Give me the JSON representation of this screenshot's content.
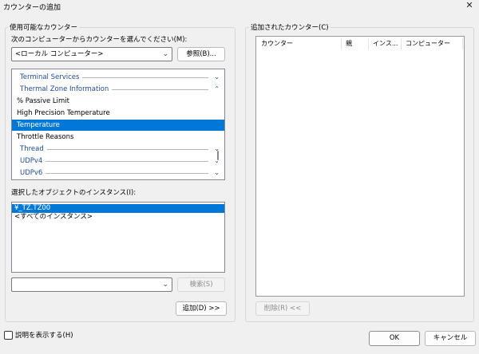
{
  "window": {
    "title": "カウンターの追加"
  },
  "available": {
    "group_label": "使用可能なカウンター",
    "computer_prompt": "次のコンピューターからカウンターを選んでください(M):",
    "computer_value": "<ローカル コンピューター>",
    "browse_label": "参照(B)...",
    "counters": [
      {
        "text": "Terminal Services",
        "kind": "category",
        "arrow": "⌄"
      },
      {
        "text": "Thermal Zone Information",
        "kind": "category",
        "arrow": "⌃"
      },
      {
        "text": "% Passive Limit",
        "kind": "counter"
      },
      {
        "text": "High Precision Temperature",
        "kind": "counter"
      },
      {
        "text": "Temperature",
        "kind": "counter",
        "selected": true
      },
      {
        "text": "Throttle Reasons",
        "kind": "counter"
      },
      {
        "text": "Thread",
        "kind": "category",
        "arrow": "⌄"
      },
      {
        "text": "UDPv4",
        "kind": "category",
        "arrow": "⌄"
      },
      {
        "text": "UDPv6",
        "kind": "category",
        "arrow": "⌄"
      }
    ],
    "instances_label": "選択したオブジェクトのインスタンス(I):",
    "instances": [
      {
        "text": "¥_TZ.TZ00",
        "selected": true
      },
      {
        "text": "<すべてのインスタンス>"
      }
    ],
    "search_value": "",
    "search_label": "検索(S)",
    "add_label": "追加(D) >>"
  },
  "added": {
    "group_label": "追加されたカウンター(C)",
    "columns": [
      "カウンター",
      "親",
      "インス...",
      "コンピューター"
    ],
    "remove_label": "削除(R) <<"
  },
  "footer": {
    "show_description_label": "説明を表示する(H)",
    "ok_label": "OK",
    "cancel_label": "キャンセル"
  }
}
